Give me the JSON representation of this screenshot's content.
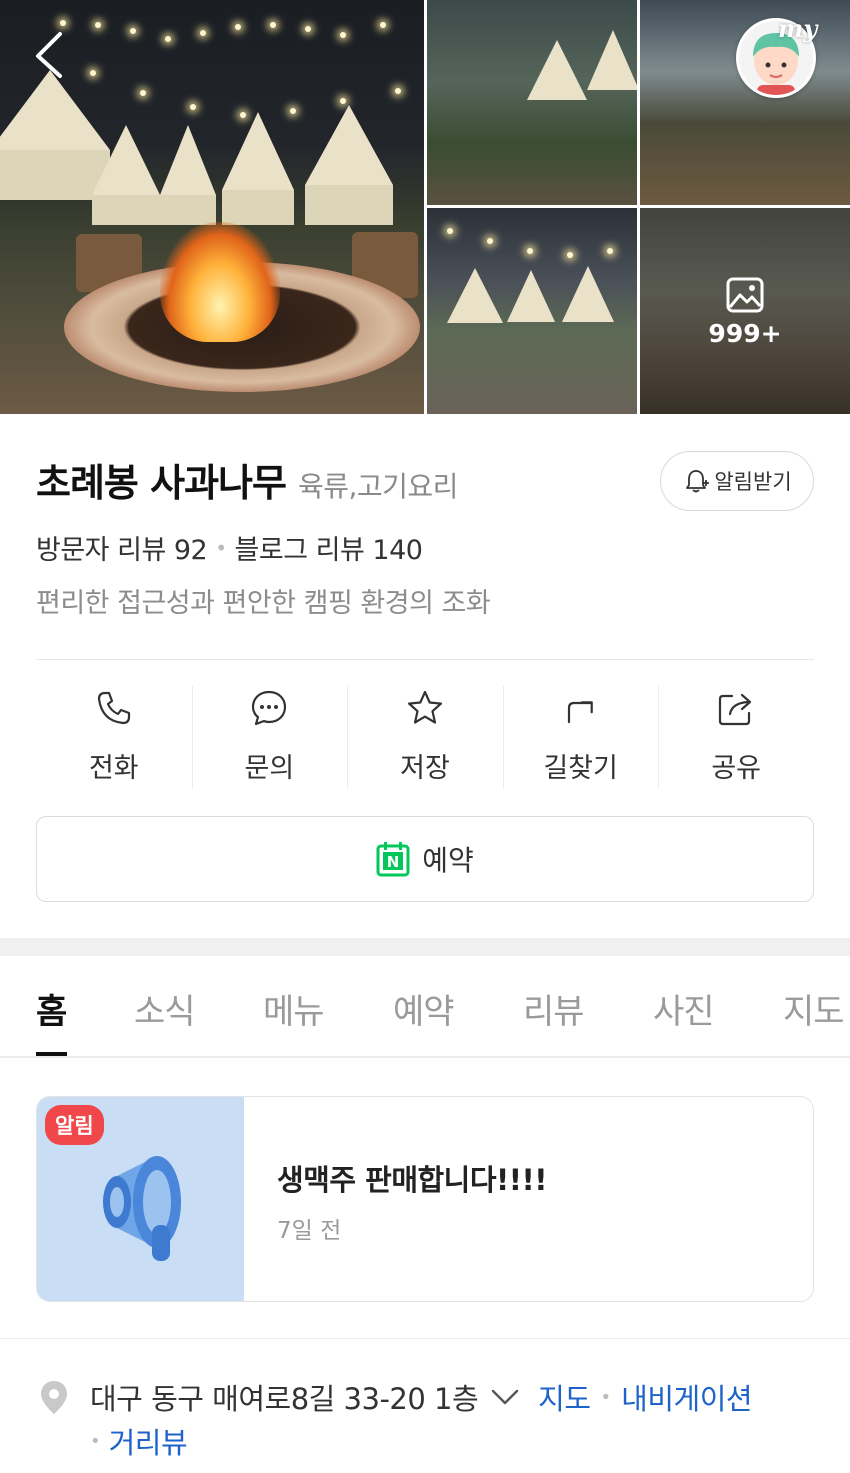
{
  "gallery": {
    "photo_count": "999+",
    "profile_tag": "my"
  },
  "place": {
    "name": "초례봉 사과나무",
    "category": "육류,고기요리",
    "alarm_label": "알림받기",
    "visitor_reviews": "방문자 리뷰 92",
    "blog_reviews": "블로그 리뷰 140",
    "description": "편리한 접근성과 편안한 캠핑 환경의 조화"
  },
  "actions": [
    {
      "label": "전화",
      "icon": "phone-icon"
    },
    {
      "label": "문의",
      "icon": "chat-icon"
    },
    {
      "label": "저장",
      "icon": "star-icon"
    },
    {
      "label": "길찾기",
      "icon": "directions-icon"
    },
    {
      "label": "공유",
      "icon": "share-icon"
    }
  ],
  "reserve": {
    "label": "예약",
    "icon_letter": "N"
  },
  "tabs": [
    "홈",
    "소식",
    "메뉴",
    "예약",
    "리뷰",
    "사진",
    "지도"
  ],
  "active_tab": "홈",
  "notice": {
    "badge": "알림",
    "title": "생맥주 판매합니다!!!!",
    "date": "7일 전"
  },
  "address": {
    "text": "대구 동구 매여로8길 33-20 1층",
    "map_link": "지도",
    "nav_link": "내비게이션",
    "street_view_link": "거리뷰"
  },
  "colors": {
    "link": "#1e63c9",
    "badge": "#f0474b",
    "naver_green": "#03c75a"
  }
}
